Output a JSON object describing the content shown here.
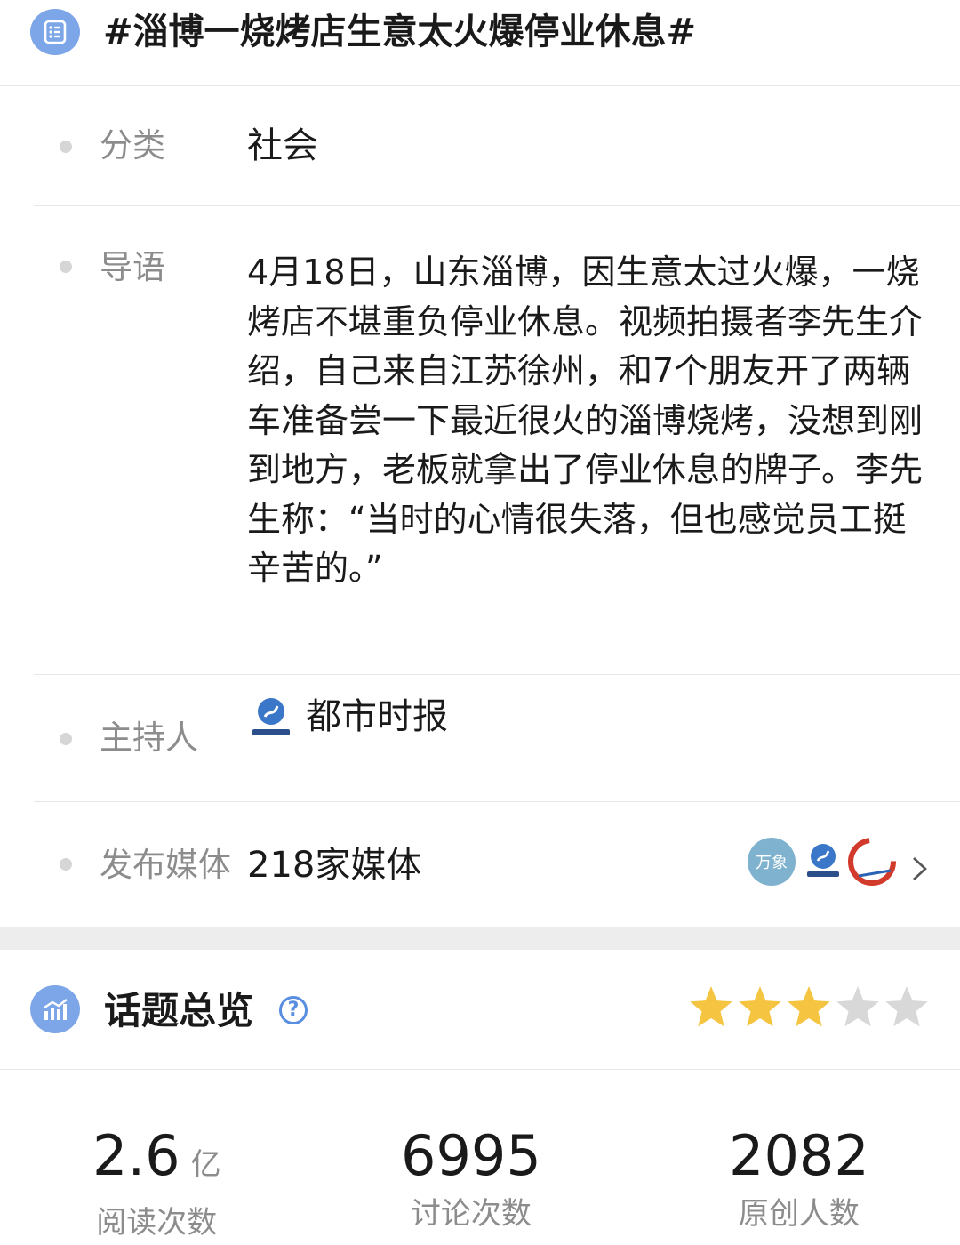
{
  "header": {
    "title": "#淄博一烧烤店生意太火爆停业休息#",
    "icon": "list-icon"
  },
  "category": {
    "label": "分类",
    "value": "社会"
  },
  "intro": {
    "label": "导语",
    "text": "4月18日，山东淄博，因生意太过火爆，一烧烤店不堪重负停业休息。视频拍摄者李先生介绍，自己来自江苏徐州，和7个朋友开了两辆车准备尝一下最近很火的淄博烧烤，没想到刚到地方，老板就拿出了停业休息的牌子。李先生称：“当时的心情很失落，但也感觉员工挺辛苦的。”"
  },
  "host": {
    "label": "主持人",
    "name": "都市时报"
  },
  "media": {
    "label": "发布媒体",
    "value": "218家媒体",
    "logo_text": "万象"
  },
  "overview": {
    "title": "话题总览",
    "help": "?",
    "rating": 3,
    "rating_max": 5,
    "colors": {
      "star_on": "#f5c542",
      "star_off": "#d8d8d8",
      "accent": "#7ca6e8"
    }
  },
  "stats": [
    {
      "value": "2.6",
      "unit": "亿",
      "label": "阅读次数"
    },
    {
      "value": "6995",
      "unit": "",
      "label": "讨论次数"
    },
    {
      "value": "2082",
      "unit": "",
      "label": "原创人数"
    }
  ]
}
